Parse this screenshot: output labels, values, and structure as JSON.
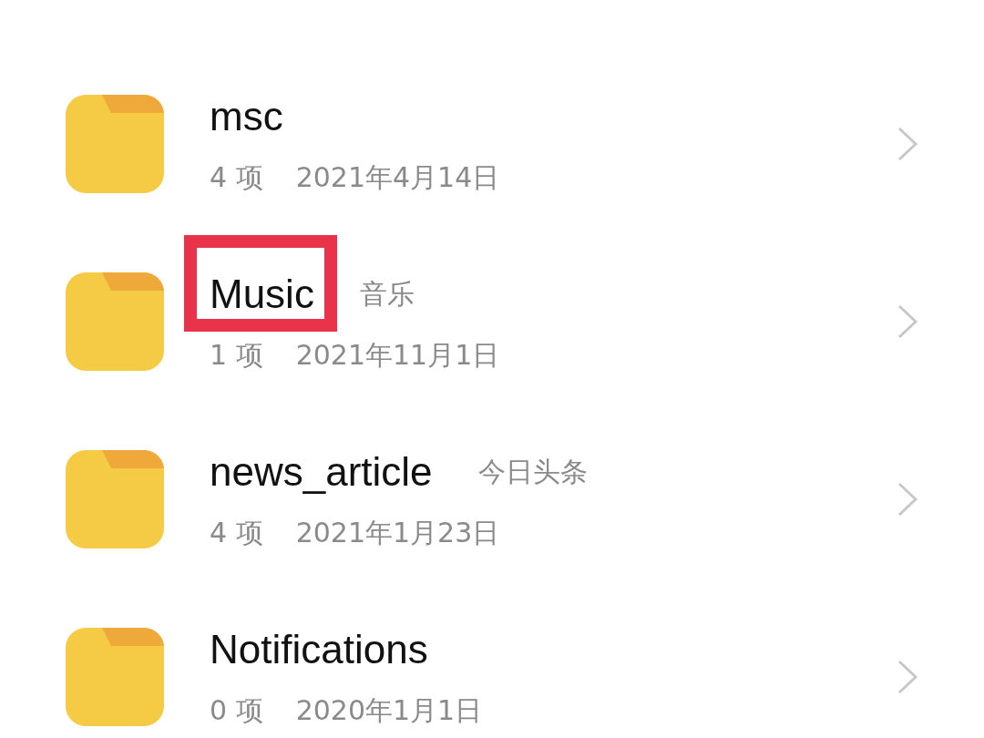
{
  "folders": [
    {
      "name": "msc",
      "count": "4 项",
      "date": "2021年4月14日",
      "highlighted": false
    },
    {
      "name": "Music",
      "subtitle": "音乐",
      "count": "1 项",
      "date": "2021年11月1日",
      "highlighted": true
    },
    {
      "name": "news_article",
      "subtitle": "今日头条",
      "count": "4 项",
      "date": "2021年1月23日",
      "highlighted": false
    },
    {
      "name": "Notifications",
      "count": "0 项",
      "date": "2020年1月1日",
      "highlighted": false
    }
  ]
}
